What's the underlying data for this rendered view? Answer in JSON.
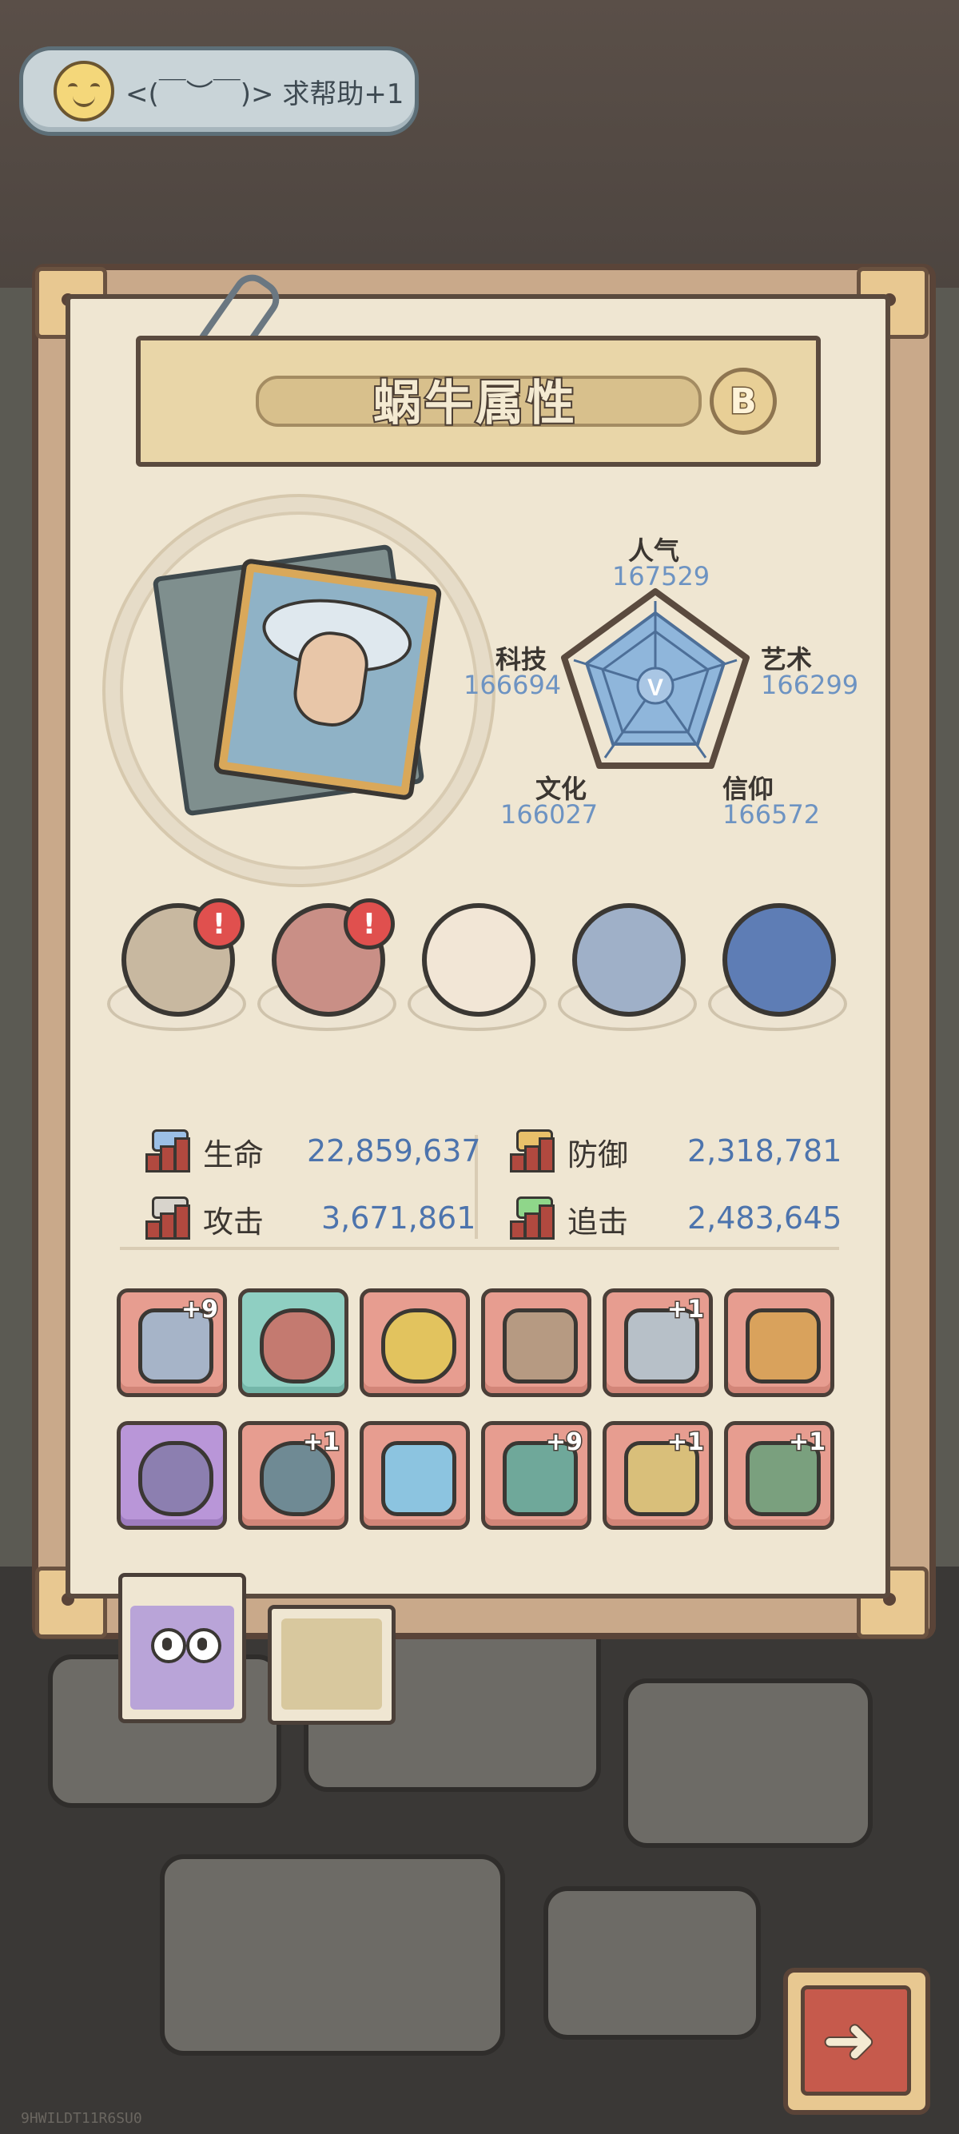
{
  "chat": {
    "icon": "smiley-icon",
    "text": "<(￣︶￣)> 求帮助+1"
  },
  "panel": {
    "title": "蜗牛属性",
    "grade": "B"
  },
  "radar": {
    "center_label": "V",
    "stats": [
      {
        "label": "人气",
        "value": "167529"
      },
      {
        "label": "艺术",
        "value": "166299"
      },
      {
        "label": "信仰",
        "value": "166572"
      },
      {
        "label": "文化",
        "value": "166027"
      },
      {
        "label": "科技",
        "value": "166694"
      }
    ],
    "fill_levels": [
      1.0,
      0.99,
      0.99,
      0.99,
      0.99
    ]
  },
  "relics": [
    {
      "name": "mechanical-octopus-relic",
      "alert": "!"
    },
    {
      "name": "fanged-skull-relic",
      "alert": "!"
    },
    {
      "name": "koi-fish-relic",
      "alert": ""
    },
    {
      "name": "compass-relic",
      "alert": ""
    },
    {
      "name": "gem-box-relic",
      "alert": ""
    }
  ],
  "combat_stats": {
    "hp": {
      "label": "生命",
      "value": "22,859,637"
    },
    "defense": {
      "label": "防御",
      "value": "2,318,781"
    },
    "attack": {
      "label": "攻击",
      "value": "3,671,861"
    },
    "chase": {
      "label": "追击",
      "value": "2,483,645"
    }
  },
  "equipment": {
    "row1": [
      {
        "name": "tentacle-sword",
        "plus": "+9"
      },
      {
        "name": "bear-head",
        "plus": ""
      },
      {
        "name": "golden-ring",
        "plus": ""
      },
      {
        "name": "stone-mask",
        "plus": ""
      },
      {
        "name": "dagger",
        "plus": "+1"
      },
      {
        "name": "winged-gauntlet",
        "plus": ""
      }
    ],
    "row2": [
      {
        "name": "koala-head",
        "plus": ""
      },
      {
        "name": "serpent-ring",
        "plus": "+1"
      },
      {
        "name": "crystal-wand",
        "plus": ""
      },
      {
        "name": "serpent-staff",
        "plus": "+9"
      },
      {
        "name": "golden-helm",
        "plus": "+1"
      },
      {
        "name": "war-hammer",
        "plus": "+1"
      }
    ]
  },
  "tabs": [
    {
      "name": "snail-tab"
    },
    {
      "name": "shell-tab"
    }
  ],
  "next": {
    "icon": "arrow-right-icon"
  },
  "watermark": "9HWILDT11R6SU0",
  "colors": {
    "stat_value": "#4d74ad",
    "radar_value": "#6d93c2",
    "alert": "#e0504e"
  }
}
